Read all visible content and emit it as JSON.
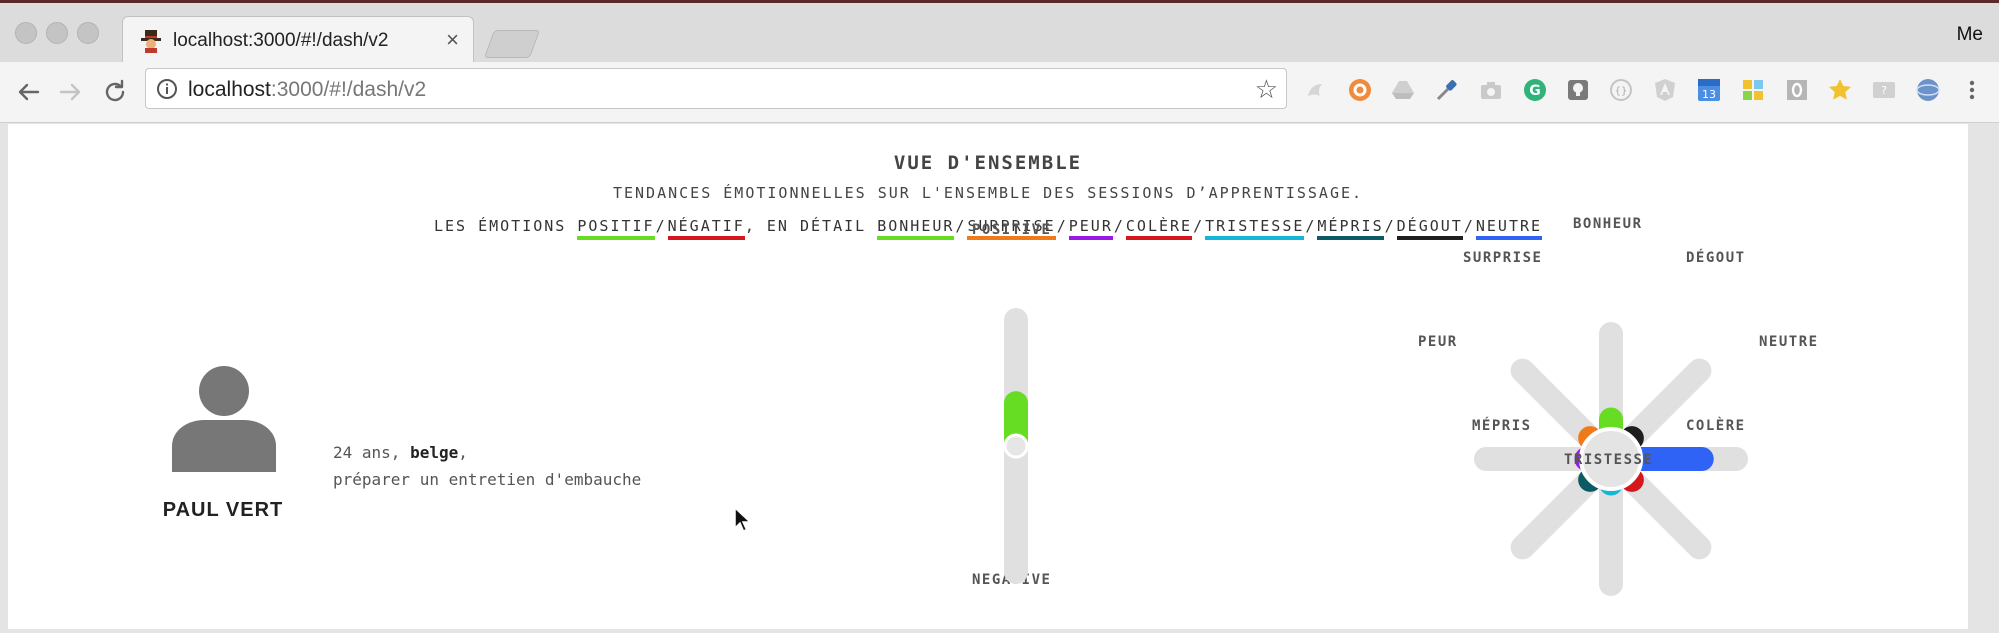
{
  "browser": {
    "tab_title": "localhost:3000/#!/dash/v2",
    "tab_close": "×",
    "url_host": "localhost",
    "url_path": ":3000/#!/dash/v2",
    "bookmark_star": "☆",
    "profile": "Me",
    "extensions": [
      "gyazo-icon",
      "lastpass-icon",
      "drive-icon",
      "eyedropper-icon",
      "camera-icon",
      "grammarly-icon",
      "idea-icon",
      "json-icon",
      "angular-icon",
      "calendar-icon",
      "tiles-icon",
      "zero-icon",
      "star-icon",
      "translate-icon",
      "globe-icon"
    ],
    "calendar_day": "13"
  },
  "header": {
    "title": "VUE D'ENSEMBLE",
    "subtitle": "TENDANCES ÉMOTIONNELLES SUR L'ENSEMBLE DES SESSIONS D’APPRENTISSAGE.",
    "legend_prefix": "LES ÉMOTIONS",
    "legend_middle": ", EN DÉTAIL",
    "positif": "POSITIF",
    "negatif": "NÉGATIF",
    "emotions": [
      {
        "key": "bonheur",
        "label": "BONHEUR",
        "color": "#66dd22"
      },
      {
        "key": "surprise",
        "label": "SURPRISE",
        "color": "#f07a1a"
      },
      {
        "key": "peur",
        "label": "PEUR",
        "color": "#9b19e6"
      },
      {
        "key": "colere",
        "label": "COLÈRE",
        "color": "#d4161d"
      },
      {
        "key": "tristesse",
        "label": "TRISTESSE",
        "color": "#15b5d6"
      },
      {
        "key": "mepris",
        "label": "MÉPRIS",
        "color": "#0c5a63"
      },
      {
        "key": "degout",
        "label": "DÉGOUT",
        "color": "#1f1f1f"
      },
      {
        "key": "neutre",
        "label": "NEUTRE",
        "color": "#2e63f5"
      }
    ],
    "positif_color": "#66dd22",
    "negatif_color": "#d4161d"
  },
  "user": {
    "name": "PAUL VERT",
    "age": "24 ans",
    "nationality": "belge",
    "goal": "préparer un entretien d'embauche"
  },
  "valence": {
    "positive_label": "POSITIVE",
    "negative_label": "NEGATIVE",
    "value": 0.17
  },
  "radar": {
    "labels": {
      "bonheur": "BONHEUR",
      "degout": "DÉGOUT",
      "neutre": "NEUTRE",
      "colere": "COLÈRE",
      "tristesse": "TRISTESSE",
      "mepris": "MÉPRIS",
      "peur": "PEUR",
      "surprise": "SURPRISE"
    },
    "values": {
      "bonheur": 0.22,
      "degout": 0.14,
      "neutre": 0.63,
      "colere": 0.14,
      "tristesse": 0.1,
      "mepris": 0.14,
      "peur": 0.1,
      "surprise": 0.14
    }
  }
}
